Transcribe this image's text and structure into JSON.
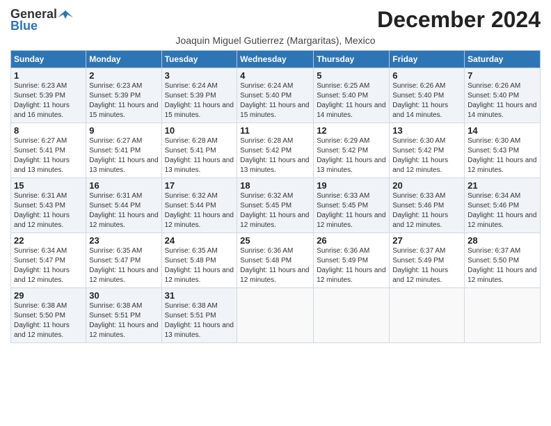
{
  "header": {
    "logo_general": "General",
    "logo_blue": "Blue",
    "month_title": "December 2024",
    "subtitle": "Joaquin Miguel Gutierrez (Margaritas), Mexico"
  },
  "days_of_week": [
    "Sunday",
    "Monday",
    "Tuesday",
    "Wednesday",
    "Thursday",
    "Friday",
    "Saturday"
  ],
  "weeks": [
    [
      {
        "day": "1",
        "text": "Sunrise: 6:23 AM\nSunset: 5:39 PM\nDaylight: 11 hours and 16 minutes."
      },
      {
        "day": "2",
        "text": "Sunrise: 6:23 AM\nSunset: 5:39 PM\nDaylight: 11 hours and 15 minutes."
      },
      {
        "day": "3",
        "text": "Sunrise: 6:24 AM\nSunset: 5:39 PM\nDaylight: 11 hours and 15 minutes."
      },
      {
        "day": "4",
        "text": "Sunrise: 6:24 AM\nSunset: 5:40 PM\nDaylight: 11 hours and 15 minutes."
      },
      {
        "day": "5",
        "text": "Sunrise: 6:25 AM\nSunset: 5:40 PM\nDaylight: 11 hours and 14 minutes."
      },
      {
        "day": "6",
        "text": "Sunrise: 6:26 AM\nSunset: 5:40 PM\nDaylight: 11 hours and 14 minutes."
      },
      {
        "day": "7",
        "text": "Sunrise: 6:26 AM\nSunset: 5:40 PM\nDaylight: 11 hours and 14 minutes."
      }
    ],
    [
      {
        "day": "8",
        "text": "Sunrise: 6:27 AM\nSunset: 5:41 PM\nDaylight: 11 hours and 13 minutes."
      },
      {
        "day": "9",
        "text": "Sunrise: 6:27 AM\nSunset: 5:41 PM\nDaylight: 11 hours and 13 minutes."
      },
      {
        "day": "10",
        "text": "Sunrise: 6:28 AM\nSunset: 5:41 PM\nDaylight: 11 hours and 13 minutes."
      },
      {
        "day": "11",
        "text": "Sunrise: 6:28 AM\nSunset: 5:42 PM\nDaylight: 11 hours and 13 minutes."
      },
      {
        "day": "12",
        "text": "Sunrise: 6:29 AM\nSunset: 5:42 PM\nDaylight: 11 hours and 13 minutes."
      },
      {
        "day": "13",
        "text": "Sunrise: 6:30 AM\nSunset: 5:42 PM\nDaylight: 11 hours and 12 minutes."
      },
      {
        "day": "14",
        "text": "Sunrise: 6:30 AM\nSunset: 5:43 PM\nDaylight: 11 hours and 12 minutes."
      }
    ],
    [
      {
        "day": "15",
        "text": "Sunrise: 6:31 AM\nSunset: 5:43 PM\nDaylight: 11 hours and 12 minutes."
      },
      {
        "day": "16",
        "text": "Sunrise: 6:31 AM\nSunset: 5:44 PM\nDaylight: 11 hours and 12 minutes."
      },
      {
        "day": "17",
        "text": "Sunrise: 6:32 AM\nSunset: 5:44 PM\nDaylight: 11 hours and 12 minutes."
      },
      {
        "day": "18",
        "text": "Sunrise: 6:32 AM\nSunset: 5:45 PM\nDaylight: 11 hours and 12 minutes."
      },
      {
        "day": "19",
        "text": "Sunrise: 6:33 AM\nSunset: 5:45 PM\nDaylight: 11 hours and 12 minutes."
      },
      {
        "day": "20",
        "text": "Sunrise: 6:33 AM\nSunset: 5:46 PM\nDaylight: 11 hours and 12 minutes."
      },
      {
        "day": "21",
        "text": "Sunrise: 6:34 AM\nSunset: 5:46 PM\nDaylight: 11 hours and 12 minutes."
      }
    ],
    [
      {
        "day": "22",
        "text": "Sunrise: 6:34 AM\nSunset: 5:47 PM\nDaylight: 11 hours and 12 minutes."
      },
      {
        "day": "23",
        "text": "Sunrise: 6:35 AM\nSunset: 5:47 PM\nDaylight: 11 hours and 12 minutes."
      },
      {
        "day": "24",
        "text": "Sunrise: 6:35 AM\nSunset: 5:48 PM\nDaylight: 11 hours and 12 minutes."
      },
      {
        "day": "25",
        "text": "Sunrise: 6:36 AM\nSunset: 5:48 PM\nDaylight: 11 hours and 12 minutes."
      },
      {
        "day": "26",
        "text": "Sunrise: 6:36 AM\nSunset: 5:49 PM\nDaylight: 11 hours and 12 minutes."
      },
      {
        "day": "27",
        "text": "Sunrise: 6:37 AM\nSunset: 5:49 PM\nDaylight: 11 hours and 12 minutes."
      },
      {
        "day": "28",
        "text": "Sunrise: 6:37 AM\nSunset: 5:50 PM\nDaylight: 11 hours and 12 minutes."
      }
    ],
    [
      {
        "day": "29",
        "text": "Sunrise: 6:38 AM\nSunset: 5:50 PM\nDaylight: 11 hours and 12 minutes."
      },
      {
        "day": "30",
        "text": "Sunrise: 6:38 AM\nSunset: 5:51 PM\nDaylight: 11 hours and 12 minutes."
      },
      {
        "day": "31",
        "text": "Sunrise: 6:38 AM\nSunset: 5:51 PM\nDaylight: 11 hours and 13 minutes."
      },
      null,
      null,
      null,
      null
    ]
  ]
}
